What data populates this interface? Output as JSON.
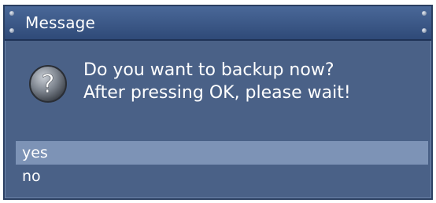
{
  "dialog": {
    "title": "Message",
    "icon": "question-icon",
    "message_lines": [
      "Do you want to backup now?",
      "After pressing OK, please wait!"
    ],
    "options": [
      {
        "label": "yes",
        "selected": true
      },
      {
        "label": "no",
        "selected": false
      }
    ]
  },
  "colors": {
    "title_bar": "#2f4a78",
    "body": "#4a6187",
    "selection": "#7d93b6",
    "text": "#ffffff"
  }
}
